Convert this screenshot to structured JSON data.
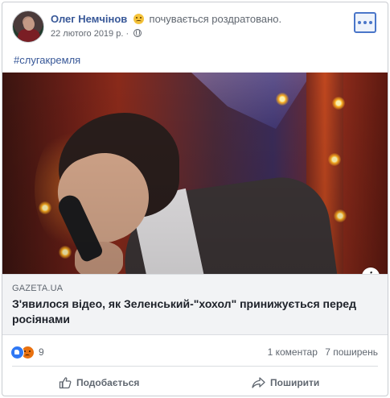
{
  "post": {
    "author": "Олег Немчінов",
    "feeling": "почувається роздратовано.",
    "timestamp": "22 лютого 2019 р. ·",
    "hashtag": "#слугакремля"
  },
  "link_preview": {
    "domain": "GAZETA.UA",
    "title": "З'явилося відео, як Зеленський-\"хохол\" принижується перед росіянами"
  },
  "engagement": {
    "reaction_count": "9",
    "comments": "1 коментар",
    "shares": "7 поширень"
  },
  "actions": {
    "like_label": "Подобається",
    "share_label": "Поширити"
  },
  "icons": {
    "more": "more-options-icon",
    "privacy": "globe-icon",
    "info": "info-icon",
    "reaction_1": "like-reaction-icon",
    "reaction_2": "angry-reaction-icon",
    "like_action": "thumbs-up-icon",
    "share_action": "share-arrow-icon"
  },
  "colors": {
    "link_blue": "#385898",
    "meta_gray": "#606770",
    "link_box_bg": "#f2f3f5",
    "like_blue": "#2f78f4",
    "angry_orange": "#e9710f"
  }
}
